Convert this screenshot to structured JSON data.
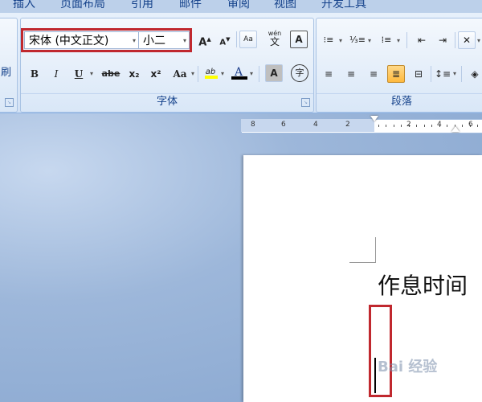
{
  "tabs": {
    "insert": "插入",
    "layout": "页面布局",
    "references": "引用",
    "mailings": "邮件",
    "review": "审阅",
    "view": "视图",
    "developer": "开发工具"
  },
  "clipboard": {
    "format_painter_label": "刷"
  },
  "font_group": {
    "label": "字体",
    "font_name": "宋体 (中文正文)",
    "font_size": "小二",
    "buttons": {
      "grow": "A",
      "shrink": "A",
      "clear": "Aa",
      "phonetic": "wén",
      "phonetic_char": "文",
      "border": "A",
      "bold": "B",
      "italic": "I",
      "underline": "U",
      "strike": "abe",
      "subscript": "x₂",
      "superscript": "x²",
      "case": "Aa",
      "highlight": "ab",
      "font_color": "A",
      "shading": "A",
      "enclose": "字"
    }
  },
  "paragraph_group": {
    "label": "段落"
  },
  "ruler": {
    "left": [
      "8",
      "6",
      "4",
      "2"
    ],
    "right": [
      "2",
      "4",
      "6"
    ]
  },
  "document": {
    "text": "作息时间"
  },
  "watermark": "Bai 经验",
  "colors": {
    "highlight": "#ffff00",
    "font_color": "#000000",
    "red_box": "#c0282e",
    "ribbon_text": "#15428b"
  }
}
